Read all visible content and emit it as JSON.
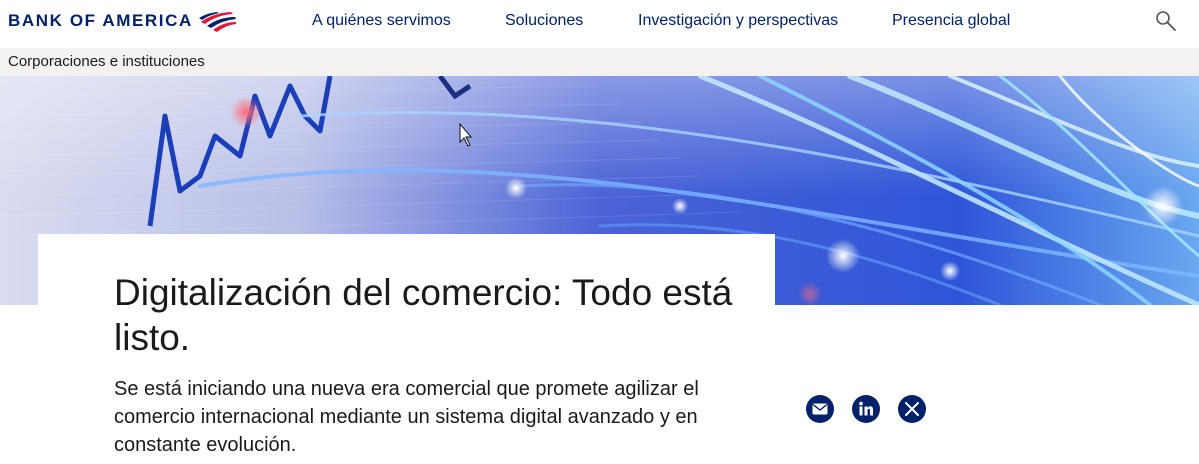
{
  "brand": {
    "name": "BANK OF AMERICA",
    "flag_color": "#e31837",
    "blue": "#012169"
  },
  "nav": {
    "items": [
      {
        "label": "A quiénes servimos"
      },
      {
        "label": "Soluciones"
      },
      {
        "label": "Investigación y perspectivas"
      },
      {
        "label": "Presencia global"
      }
    ],
    "search_icon": "search-icon"
  },
  "subnav": {
    "label": "Corporaciones e instituciones"
  },
  "hero": {
    "image": "fiber-optic-data-visual"
  },
  "article": {
    "headline": "Digitalización del comercio: Todo está listo.",
    "dek": "Se está iniciando una nueva era comercial que promete agilizar el comercio internacional mediante un sistema digital avanzado y en constante evolución."
  },
  "share": {
    "icons": [
      "email-icon",
      "linkedin-icon",
      "x-icon"
    ]
  }
}
